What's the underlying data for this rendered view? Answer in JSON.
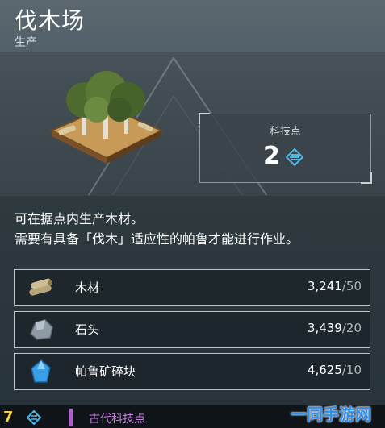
{
  "header": {
    "title": "伐木场",
    "category": "生产"
  },
  "tech": {
    "label": "科技点",
    "value": "2",
    "icon": "tech-point-icon"
  },
  "description": {
    "line1": "可在据点内生产木材。",
    "line2": "需要有具备「伐木」适应性的帕鲁才能进行作业。"
  },
  "materials": [
    {
      "icon": "wood-icon",
      "name": "木材",
      "have": "3,241",
      "need": "/50"
    },
    {
      "icon": "stone-icon",
      "name": "石头",
      "have": "3,439",
      "need": "/20"
    },
    {
      "icon": "pal-fragment-icon",
      "name": "帕鲁矿碎块",
      "have": "4,625",
      "need": "/10"
    }
  ],
  "footer": {
    "points": "7",
    "era": "古代科技点"
  },
  "watermark": "一同手游网",
  "colors": {
    "accent_blue": "#4fb8e6",
    "footer_gold": "#f2d14a",
    "era_purple": "#c87de0"
  }
}
